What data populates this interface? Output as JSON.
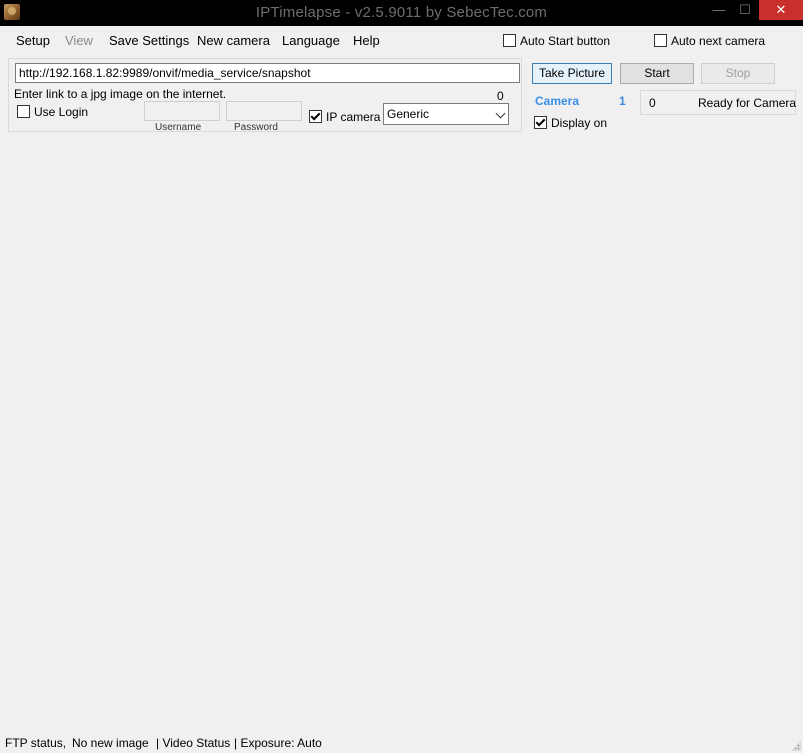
{
  "window": {
    "title": "IPTimelapse - v2.5.9011 by SebecTec.com",
    "minimize_glyph": "—",
    "maximize_glyph": "☐",
    "close_glyph": "✕"
  },
  "menu": {
    "setup": "Setup",
    "view": "View",
    "save_settings": "Save Settings",
    "new_camera": "New camera",
    "language": "Language",
    "help": "Help"
  },
  "options": {
    "auto_start_button": "Auto Start button",
    "auto_next_camera": "Auto next camera"
  },
  "source": {
    "url_value": "http://192.168.1.82:9989/onvif/media_service/snapshot",
    "hint": "Enter link to a jpg image on the internet.",
    "count": "0",
    "use_login": "Use Login",
    "username_label": "Username",
    "password_label": "Password",
    "ip_camera": "IP camera",
    "camera_type": "Generic"
  },
  "controls": {
    "take_picture": "Take Picture",
    "start": "Start",
    "stop": "Stop",
    "camera_label": "Camera",
    "camera_number": "1",
    "image_count": "0",
    "status": "Ready for Camera",
    "display_on": "Display on"
  },
  "statusbar": {
    "ftp": "FTP status,",
    "image": "No new image",
    "video": "| Video Status",
    "exposure": "| Exposure: Auto"
  },
  "colors": {
    "accent": "#3a8ee6",
    "close_button": "#c7302b",
    "titlebar": "#000000"
  }
}
